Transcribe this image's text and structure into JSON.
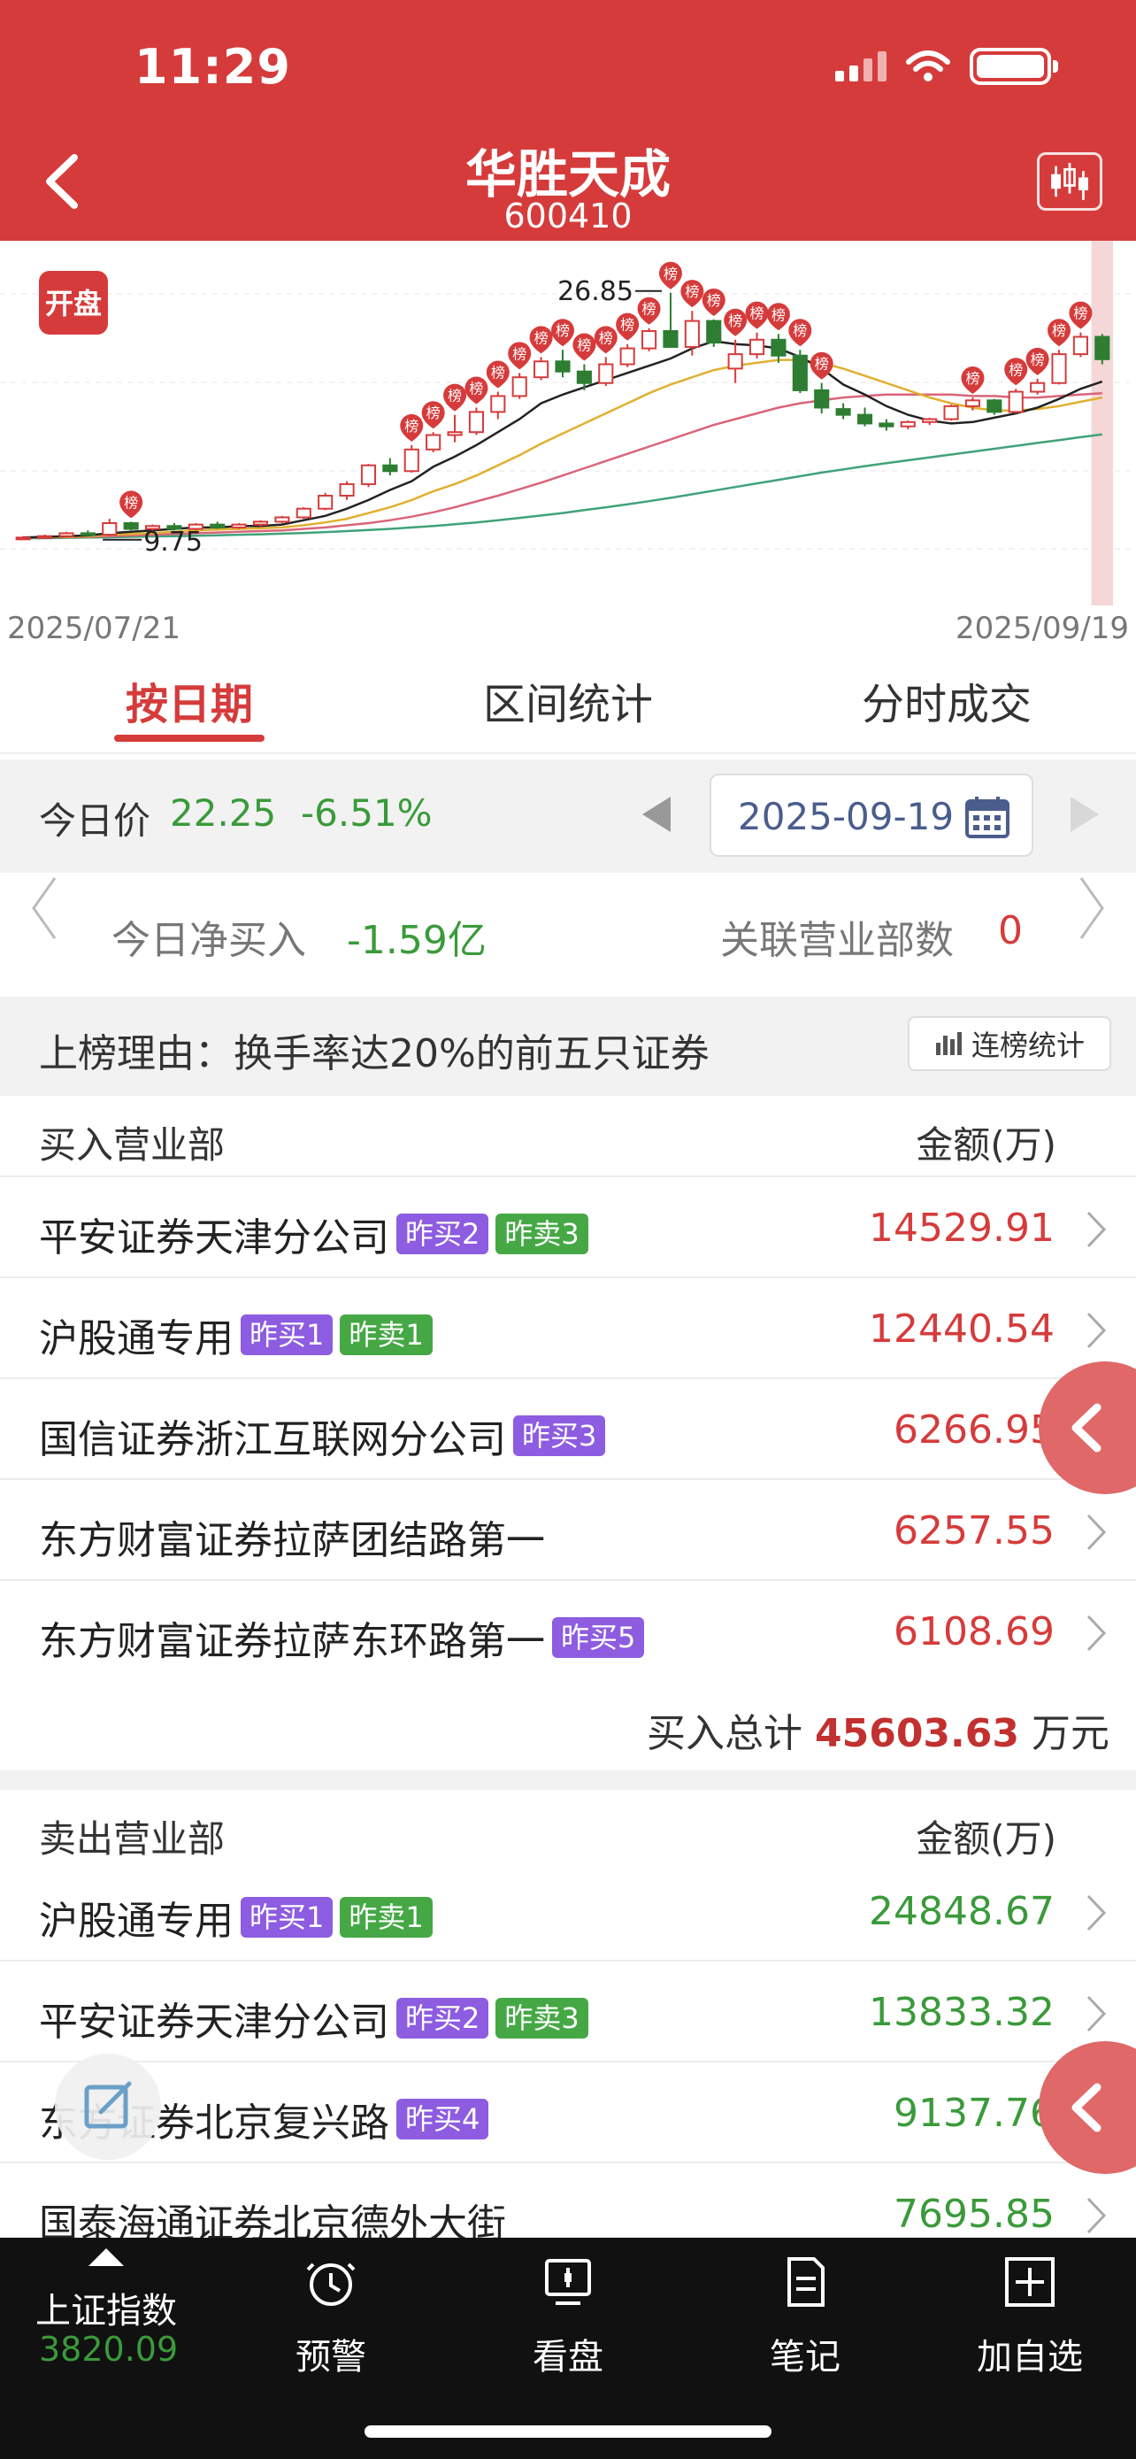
{
  "status": {
    "time": "11:29"
  },
  "header": {
    "title": "华胜天成",
    "code": "600410"
  },
  "chart": {
    "badge": "开盘",
    "start_date": "2025/07/21",
    "end_date": "2025/09/19",
    "high_label": "26.85",
    "low_label": "9.75",
    "marker_label": "榜",
    "colors": {
      "up": "#d63b3b",
      "down": "#2e7d32",
      "ma5": "#222222",
      "ma10": "#e0b030",
      "ma20": "#d9657a",
      "ma60": "#3fa27a"
    }
  },
  "chart_data": {
    "type": "candlestick",
    "x_range": [
      "2025/07/21",
      "2025/09/19"
    ],
    "annotations": [
      {
        "label": "26.85",
        "kind": "high"
      },
      {
        "label": "9.75",
        "kind": "low"
      }
    ],
    "candles": [
      {
        "o": 9.8,
        "h": 10.0,
        "l": 9.75,
        "c": 9.9
      },
      {
        "o": 9.9,
        "h": 10.1,
        "l": 9.8,
        "c": 10.0
      },
      {
        "o": 10.0,
        "h": 10.3,
        "l": 9.9,
        "c": 10.2
      },
      {
        "o": 10.2,
        "h": 10.4,
        "l": 10.0,
        "c": 10.1
      },
      {
        "o": 10.1,
        "h": 11.2,
        "l": 10.0,
        "c": 10.9
      },
      {
        "o": 10.9,
        "h": 11.0,
        "l": 10.4,
        "c": 10.5
      },
      {
        "o": 10.5,
        "h": 10.8,
        "l": 10.3,
        "c": 10.7
      },
      {
        "o": 10.7,
        "h": 10.9,
        "l": 10.4,
        "c": 10.5
      },
      {
        "o": 10.5,
        "h": 10.9,
        "l": 10.4,
        "c": 10.8
      },
      {
        "o": 10.8,
        "h": 11.0,
        "l": 10.5,
        "c": 10.6
      },
      {
        "o": 10.6,
        "h": 10.9,
        "l": 10.5,
        "c": 10.8
      },
      {
        "o": 10.8,
        "h": 11.1,
        "l": 10.6,
        "c": 11.0
      },
      {
        "o": 11.0,
        "h": 11.4,
        "l": 10.9,
        "c": 11.3
      },
      {
        "o": 11.3,
        "h": 12.0,
        "l": 11.2,
        "c": 11.9
      },
      {
        "o": 11.9,
        "h": 13.0,
        "l": 11.8,
        "c": 12.8
      },
      {
        "o": 12.8,
        "h": 13.8,
        "l": 12.5,
        "c": 13.6
      },
      {
        "o": 13.6,
        "h": 15.0,
        "l": 13.4,
        "c": 14.9
      },
      {
        "o": 14.9,
        "h": 15.4,
        "l": 14.2,
        "c": 14.5
      },
      {
        "o": 14.5,
        "h": 16.3,
        "l": 14.4,
        "c": 16.0
      },
      {
        "o": 16.0,
        "h": 17.2,
        "l": 15.8,
        "c": 17.0
      },
      {
        "o": 17.0,
        "h": 18.4,
        "l": 16.5,
        "c": 17.2
      },
      {
        "o": 17.2,
        "h": 18.9,
        "l": 17.0,
        "c": 18.6
      },
      {
        "o": 18.6,
        "h": 20.0,
        "l": 18.1,
        "c": 19.7
      },
      {
        "o": 19.7,
        "h": 21.3,
        "l": 19.5,
        "c": 21.0
      },
      {
        "o": 21.0,
        "h": 22.4,
        "l": 20.8,
        "c": 22.1
      },
      {
        "o": 22.1,
        "h": 22.9,
        "l": 21.0,
        "c": 21.4
      },
      {
        "o": 21.4,
        "h": 21.9,
        "l": 20.1,
        "c": 20.6
      },
      {
        "o": 20.6,
        "h": 22.4,
        "l": 20.4,
        "c": 21.9
      },
      {
        "o": 21.9,
        "h": 23.3,
        "l": 21.7,
        "c": 23.0
      },
      {
        "o": 23.0,
        "h": 24.4,
        "l": 22.8,
        "c": 24.2
      },
      {
        "o": 24.2,
        "h": 26.85,
        "l": 24.0,
        "c": 23.1
      },
      {
        "o": 23.1,
        "h": 25.6,
        "l": 22.5,
        "c": 24.9
      },
      {
        "o": 24.9,
        "h": 25.0,
        "l": 23.1,
        "c": 23.4
      },
      {
        "o": 21.6,
        "h": 23.6,
        "l": 20.6,
        "c": 22.6
      },
      {
        "o": 22.6,
        "h": 24.1,
        "l": 22.3,
        "c": 23.6
      },
      {
        "o": 23.6,
        "h": 24.0,
        "l": 22.0,
        "c": 22.5
      },
      {
        "o": 22.5,
        "h": 22.9,
        "l": 19.9,
        "c": 20.1
      },
      {
        "o": 20.1,
        "h": 20.6,
        "l": 18.5,
        "c": 18.9
      },
      {
        "o": 18.8,
        "h": 19.2,
        "l": 18.1,
        "c": 18.4
      },
      {
        "o": 18.4,
        "h": 18.9,
        "l": 17.6,
        "c": 17.8
      },
      {
        "o": 17.8,
        "h": 18.1,
        "l": 17.3,
        "c": 17.6
      },
      {
        "o": 17.6,
        "h": 18.0,
        "l": 17.4,
        "c": 17.9
      },
      {
        "o": 17.9,
        "h": 18.2,
        "l": 17.7,
        "c": 18.1
      },
      {
        "o": 18.1,
        "h": 19.1,
        "l": 18.0,
        "c": 19.0
      },
      {
        "o": 19.0,
        "h": 19.6,
        "l": 18.7,
        "c": 19.4
      },
      {
        "o": 19.4,
        "h": 19.5,
        "l": 18.4,
        "c": 18.6
      },
      {
        "o": 18.6,
        "h": 20.2,
        "l": 18.5,
        "c": 20.0
      },
      {
        "o": 20.0,
        "h": 20.9,
        "l": 19.8,
        "c": 20.6
      },
      {
        "o": 20.6,
        "h": 22.9,
        "l": 20.5,
        "c": 22.6
      },
      {
        "o": 22.6,
        "h": 24.1,
        "l": 22.4,
        "c": 23.8
      },
      {
        "o": 23.8,
        "h": 24.0,
        "l": 21.9,
        "c": 22.25
      }
    ],
    "ma5": [
      9.9,
      9.95,
      10.0,
      10.05,
      10.2,
      10.3,
      10.4,
      10.5,
      10.6,
      10.6,
      10.7,
      10.7,
      10.8,
      11.1,
      11.4,
      11.9,
      12.5,
      13.2,
      13.8,
      14.8,
      15.5,
      16.3,
      17.2,
      18.1,
      19.2,
      19.8,
      20.3,
      20.8,
      21.3,
      21.8,
      22.3,
      23.0,
      23.5,
      23.3,
      23.2,
      23.0,
      22.4,
      21.6,
      20.5,
      19.8,
      19.0,
      18.4,
      18.0,
      17.8,
      17.9,
      18.2,
      18.5,
      18.9,
      19.5,
      20.2,
      20.7
    ],
    "ma10": [
      9.9,
      9.92,
      9.95,
      10.0,
      10.1,
      10.15,
      10.2,
      10.3,
      10.4,
      10.45,
      10.5,
      10.55,
      10.6,
      10.75,
      10.95,
      11.2,
      11.6,
      12.0,
      12.5,
      13.1,
      13.6,
      14.2,
      14.9,
      15.6,
      16.4,
      17.1,
      17.8,
      18.5,
      19.2,
      19.9,
      20.5,
      21.0,
      21.5,
      21.8,
      22.0,
      22.2,
      22.2,
      22.0,
      21.6,
      21.1,
      20.6,
      20.1,
      19.6,
      19.2,
      18.9,
      18.7,
      18.7,
      18.8,
      19.0,
      19.3,
      19.6
    ],
    "ma20": [
      9.9,
      9.9,
      9.92,
      9.95,
      10.0,
      10.05,
      10.1,
      10.15,
      10.2,
      10.25,
      10.3,
      10.35,
      10.4,
      10.5,
      10.6,
      10.75,
      10.9,
      11.1,
      11.35,
      11.65,
      12.0,
      12.4,
      12.8,
      13.25,
      13.7,
      14.2,
      14.7,
      15.2,
      15.7,
      16.2,
      16.7,
      17.2,
      17.7,
      18.1,
      18.5,
      18.9,
      19.2,
      19.4,
      19.6,
      19.7,
      19.8,
      19.8,
      19.8,
      19.8,
      19.7,
      19.7,
      19.6,
      19.6,
      19.7,
      19.8,
      19.9
    ],
    "ma60": [
      9.85,
      9.86,
      9.88,
      9.9,
      9.92,
      9.95,
      9.98,
      10.0,
      10.03,
      10.06,
      10.1,
      10.13,
      10.17,
      10.22,
      10.28,
      10.35,
      10.42,
      10.5,
      10.6,
      10.7,
      10.82,
      10.95,
      11.1,
      11.26,
      11.43,
      11.6,
      11.8,
      12.0,
      12.2,
      12.42,
      12.65,
      12.9,
      13.15,
      13.4,
      13.65,
      13.9,
      14.15,
      14.4,
      14.62,
      14.85,
      15.05,
      15.25,
      15.45,
      15.65,
      15.85,
      16.05,
      16.25,
      16.45,
      16.65,
      16.85,
      17.05
    ],
    "markers": [
      5,
      18,
      19,
      20,
      21,
      22,
      23,
      24,
      25,
      26,
      27,
      28,
      29,
      30,
      31,
      32,
      33,
      34,
      35,
      36,
      37,
      44,
      46,
      47,
      48,
      49
    ]
  },
  "tabs": [
    {
      "label": "按日期",
      "active": true
    },
    {
      "label": "区间统计",
      "active": false
    },
    {
      "label": "分时成交",
      "active": false
    }
  ],
  "price": {
    "label": "今日价",
    "value": "22.25",
    "change": "-6.51%",
    "date": "2025-09-19"
  },
  "net": {
    "label": "今日净买入",
    "value": "-1.59亿",
    "rel_label": "关联营业部数",
    "rel_value": "0"
  },
  "reason": {
    "text": "上榜理由：换手率达20%的前五只证券",
    "button": "连榜统计"
  },
  "buy": {
    "header": "买入营业部",
    "amount_header": "金额(万)",
    "rows": [
      {
        "name": "平安证券天津分公司",
        "badges": [
          {
            "text": "昨买2",
            "type": "buy"
          },
          {
            "text": "昨卖3",
            "type": "sell"
          }
        ],
        "amount": "14529.91"
      },
      {
        "name": "沪股通专用",
        "badges": [
          {
            "text": "昨买1",
            "type": "buy"
          },
          {
            "text": "昨卖1",
            "type": "sell"
          }
        ],
        "amount": "12440.54"
      },
      {
        "name": "国信证券浙江互联网分公司",
        "badges": [
          {
            "text": "昨买3",
            "type": "buy"
          }
        ],
        "amount": "6266.95"
      },
      {
        "name": "东方财富证券拉萨团结路第一",
        "badges": [],
        "amount": "6257.55"
      },
      {
        "name": "东方财富证券拉萨东环路第一",
        "badges": [
          {
            "text": "昨买5",
            "type": "buy"
          }
        ],
        "amount": "6108.69"
      }
    ],
    "total_label": "买入总计",
    "total_value": "45603.63",
    "total_unit": "万元"
  },
  "sell": {
    "header": "卖出营业部",
    "amount_header": "金额(万)",
    "rows": [
      {
        "name": "沪股通专用",
        "badges": [
          {
            "text": "昨买1",
            "type": "buy"
          },
          {
            "text": "昨卖1",
            "type": "sell"
          }
        ],
        "amount": "24848.67"
      },
      {
        "name": "平安证券天津分公司",
        "badges": [
          {
            "text": "昨买2",
            "type": "buy"
          },
          {
            "text": "昨卖3",
            "type": "sell"
          }
        ],
        "amount": "13833.32"
      },
      {
        "name": "东方证券北京复兴路",
        "badges": [
          {
            "text": "昨买4",
            "type": "buy"
          }
        ],
        "amount": "9137.76"
      },
      {
        "name": "国泰海通证券北京德外大街",
        "badges": [],
        "amount": "7695.85"
      }
    ]
  },
  "bottom_nav": {
    "index_label": "上证指数",
    "index_value": "3820.09",
    "items": [
      {
        "label": "预警",
        "icon": "alarm-clock-icon"
      },
      {
        "label": "看盘",
        "icon": "monitor-chart-icon"
      },
      {
        "label": "笔记",
        "icon": "note-icon"
      },
      {
        "label": "加自选",
        "icon": "plus-box-icon"
      }
    ]
  }
}
